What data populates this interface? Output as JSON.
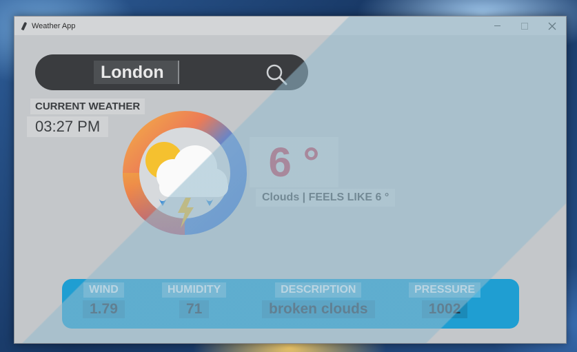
{
  "window": {
    "title": "Weather App"
  },
  "search": {
    "value": "London"
  },
  "current": {
    "label": "CURRENT WEATHER",
    "time": "03:27 PM",
    "temperature": "6 °",
    "feels": "Clouds | FEELS LIKE 6 °"
  },
  "info": {
    "wind": {
      "label": "WIND",
      "value": "1.79"
    },
    "humidity": {
      "label": "HUMIDITY",
      "value": "71"
    },
    "description": {
      "label": "DESCRIPTION",
      "value": "broken clouds"
    },
    "pressure": {
      "label": "PRESSURE",
      "value": "1002"
    }
  },
  "colors": {
    "temperature": "#c24a5f",
    "info_panel": "#1f9ed2",
    "search_bar": "#3a3c3f"
  },
  "icons": [
    "feather-icon",
    "search-icon",
    "cloud-storm-icon"
  ]
}
